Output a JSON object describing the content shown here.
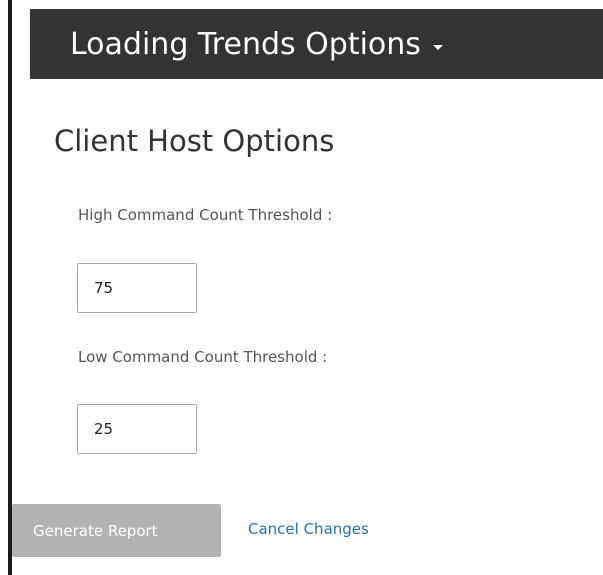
{
  "header": {
    "title": "Loading Trends Options",
    "dropdown_icon": "caret-down-icon",
    "background_color": "#333333"
  },
  "section": {
    "title": "Client Host Options"
  },
  "fields": {
    "high_threshold": {
      "label": "High Command Count Threshold :",
      "value": "75"
    },
    "low_threshold": {
      "label": "Low Command Count Threshold :",
      "value": "25"
    }
  },
  "actions": {
    "generate_label": "Generate Report",
    "cancel_label": "Cancel Changes",
    "link_color": "#2b6fb3",
    "disabled_button_color": "#b3b3b3"
  }
}
